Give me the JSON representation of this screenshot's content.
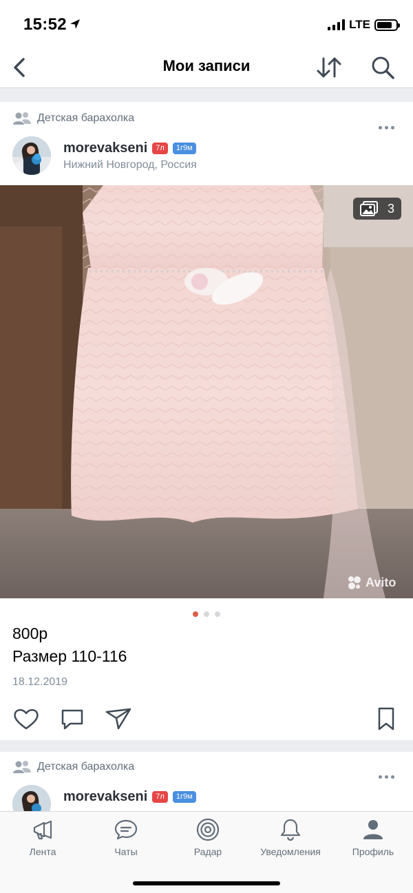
{
  "status_bar": {
    "time": "15:52",
    "network": "LTE"
  },
  "nav": {
    "title": "Мои записи"
  },
  "posts": [
    {
      "group": "Детская барахолка",
      "author": "morevakseni",
      "badge_age": "7л",
      "badge_time": "1г9м",
      "location": "Нижний Новгород, Россия",
      "photo_count": "3",
      "watermark": "Avito",
      "price": "800р",
      "description": "Размер 110-116",
      "date": "18.12.2019"
    },
    {
      "group": "Детская барахолка",
      "author": "morevakseni",
      "badge_age": "7л",
      "badge_time": "1г9м"
    }
  ],
  "tabs": [
    {
      "label": "Лента",
      "icon": "megaphone-icon"
    },
    {
      "label": "Чаты",
      "icon": "chat-icon"
    },
    {
      "label": "Радар",
      "icon": "radar-icon"
    },
    {
      "label": "Уведомления",
      "icon": "bell-icon"
    },
    {
      "label": "Профиль",
      "icon": "person-icon"
    }
  ],
  "colors": {
    "accent": "#e05b45",
    "badge_age": "#e64646",
    "badge_time": "#4a8fe0",
    "secondary_text": "#818c99"
  }
}
